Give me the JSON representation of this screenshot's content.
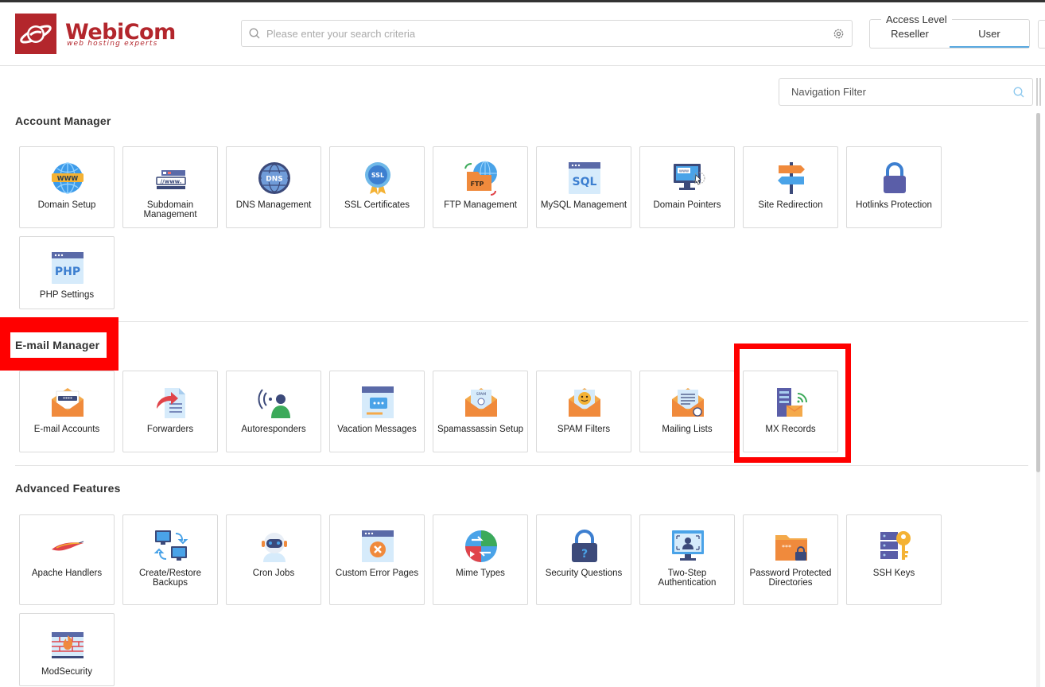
{
  "brand": {
    "name": "WebiCom",
    "tagline": "web hosting experts"
  },
  "search": {
    "placeholder": "Please enter your search criteria"
  },
  "access_level": {
    "legend": "Access Level",
    "options": [
      "Reseller",
      "User"
    ],
    "selected": "User"
  },
  "nav_filter": {
    "placeholder": "Navigation Filter"
  },
  "sections": [
    {
      "title": "Account Manager",
      "items": [
        {
          "label": "Domain Setup",
          "icon": "globe-www-icon"
        },
        {
          "label": "Subdomain Management",
          "icon": "subdomain-icon"
        },
        {
          "label": "DNS Management",
          "icon": "dns-globe-icon"
        },
        {
          "label": "SSL Certificates",
          "icon": "ssl-badge-icon"
        },
        {
          "label": "FTP Management",
          "icon": "ftp-icon"
        },
        {
          "label": "MySQL Management",
          "icon": "sql-database-icon"
        },
        {
          "label": "Domain Pointers",
          "icon": "domain-pointer-icon"
        },
        {
          "label": "Site Redirection",
          "icon": "signpost-icon"
        },
        {
          "label": "Hotlinks Protection",
          "icon": "padlock-icon"
        },
        {
          "label": "PHP Settings",
          "icon": "php-icon"
        }
      ]
    },
    {
      "title": "E-mail Manager",
      "items": [
        {
          "label": "E-mail Accounts",
          "icon": "envelope-password-icon"
        },
        {
          "label": "Forwarders",
          "icon": "forward-document-icon"
        },
        {
          "label": "Autoresponders",
          "icon": "auto-reply-person-icon"
        },
        {
          "label": "Vacation Messages",
          "icon": "vacation-message-icon"
        },
        {
          "label": "Spamassassin Setup",
          "icon": "spam-envelope-icon"
        },
        {
          "label": "SPAM Filters",
          "icon": "spam-filter-envelope-icon"
        },
        {
          "label": "Mailing Lists",
          "icon": "mailing-list-icon"
        },
        {
          "label": "MX Records",
          "icon": "mx-server-icon"
        }
      ]
    },
    {
      "title": "Advanced Features",
      "items": [
        {
          "label": "Apache Handlers",
          "icon": "apache-feather-icon"
        },
        {
          "label": "Create/Restore Backups",
          "icon": "backup-monitors-icon"
        },
        {
          "label": "Cron Jobs",
          "icon": "cron-robot-icon"
        },
        {
          "label": "Custom Error Pages",
          "icon": "error-page-icon"
        },
        {
          "label": "Mime Types",
          "icon": "mime-types-icon"
        },
        {
          "label": "Security Questions",
          "icon": "security-lock-question-icon"
        },
        {
          "label": "Two-Step Authentication",
          "icon": "two-step-auth-icon"
        },
        {
          "label": "Password Protected Directories",
          "icon": "protected-folder-icon"
        },
        {
          "label": "SSH Keys",
          "icon": "ssh-key-server-icon"
        },
        {
          "label": "ModSecurity",
          "icon": "firewall-icon"
        }
      ]
    }
  ],
  "colors": {
    "brand": "#b3262c",
    "highlight": "#ff0000",
    "accent": "#5aa9e0"
  }
}
